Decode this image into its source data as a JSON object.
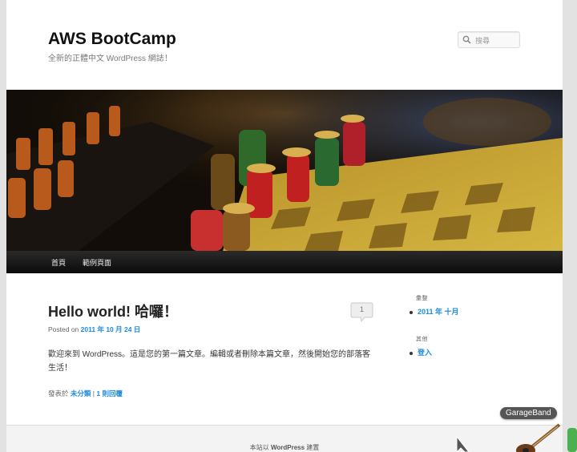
{
  "site": {
    "title": "AWS BootCamp",
    "description": "全新的正體中文 WordPress 網誌！"
  },
  "search": {
    "placeholder": "搜尋"
  },
  "nav": {
    "items": [
      {
        "label": "首頁"
      },
      {
        "label": "範例頁面"
      }
    ]
  },
  "post": {
    "title": "Hello world! 哈囉！",
    "comment_count": "1",
    "posted_on_label": "Posted on",
    "date": "2011 年 10 月 24 日",
    "body": "歡迎來到 WordPress。這是您的第一篇文章。編輯或者刪除本篇文章，然後開始您的部落客生活！",
    "posted_in_label": "發表於",
    "category": "未分類",
    "separator": "|",
    "reply_link": "1 則回覆"
  },
  "sidebar": {
    "archives": {
      "title": "彙整",
      "items": [
        "2011 年 十月"
      ]
    },
    "meta": {
      "title": "其他",
      "items": [
        "登入"
      ]
    }
  },
  "footer": {
    "credit_prefix": "本站以",
    "credit_brand": "WordPress",
    "credit_suffix": "建置"
  },
  "dock": {
    "tooltip": "GarageBand"
  },
  "colors": {
    "link": "#1b8be0",
    "nav_bg": "#111111",
    "page_bg": "#e2e2e2"
  },
  "icons": {
    "search": "search-icon",
    "comment": "speech-bubble-icon",
    "garageband": "guitar-icon",
    "cursor": "pointer-cursor-icon"
  }
}
